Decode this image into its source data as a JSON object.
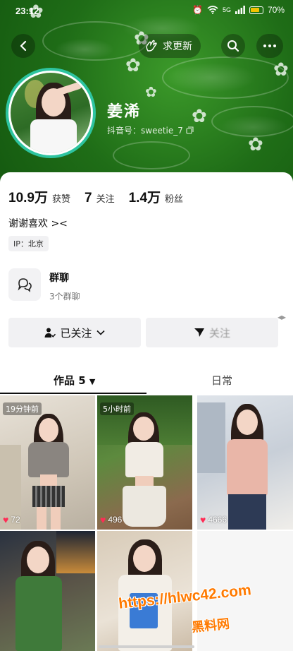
{
  "status_bar": {
    "time": "23:12",
    "battery": "70%",
    "network": "5G"
  },
  "header": {
    "update_button_label": "求更新"
  },
  "profile": {
    "nickname": "姜浠",
    "douyin_id": "抖音号：sweetie_7",
    "stats": [
      {
        "value": "10.9万",
        "label": "获赞"
      },
      {
        "value": "7",
        "label": "关注"
      },
      {
        "value": "1.4万",
        "label": "粉丝"
      }
    ],
    "bio": "谢谢喜欢 ><",
    "ip": "IP：北京"
  },
  "group_chat": {
    "title": "群聊",
    "subtitle": "3个群聊"
  },
  "actions": {
    "follow_label": "已关注",
    "share_label": "关注"
  },
  "tabs": [
    {
      "label": "作品 5",
      "active": true
    },
    {
      "label": "日常",
      "active": false
    }
  ],
  "videos": [
    {
      "time_badge": "19分钟前",
      "likes": "72"
    },
    {
      "time_badge": "5小时前",
      "likes": "496"
    },
    {
      "time_badge": "",
      "likes": "4666"
    },
    {
      "time_badge": "",
      "likes": ""
    },
    {
      "time_badge": "",
      "likes": ""
    }
  ],
  "watermark": {
    "url": "https://hlwc42.com",
    "site": "黑料网"
  },
  "colors": {
    "accent_ring": "#2ec4a0",
    "banner_green": "#2f8a22",
    "like_heart": "#ff2c55",
    "watermark": "#ff7a00"
  }
}
